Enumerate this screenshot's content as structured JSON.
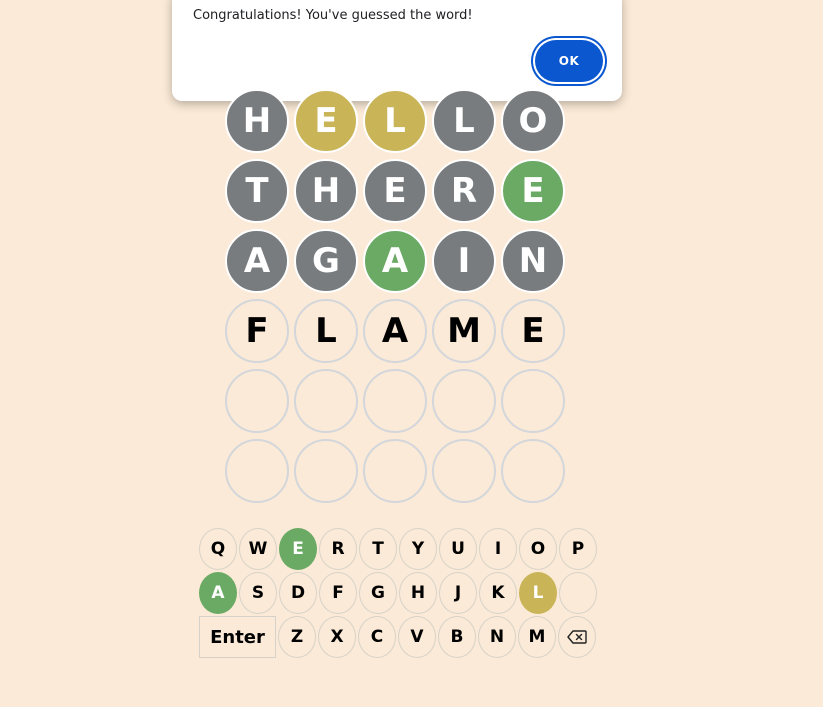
{
  "dialog": {
    "message": "Congratulations! You've guessed the word!",
    "ok_label": "OK"
  },
  "colors": {
    "background": "#fbead7",
    "absent": "#787c7e",
    "present": "#c9b458",
    "correct": "#6aaa64",
    "ok_button": "#0b57d0"
  },
  "board": {
    "rows": [
      {
        "letters": [
          "H",
          "E",
          "L",
          "L",
          "O"
        ],
        "states": [
          "absent",
          "present",
          "present",
          "absent",
          "absent"
        ]
      },
      {
        "letters": [
          "T",
          "H",
          "E",
          "R",
          "E"
        ],
        "states": [
          "absent",
          "absent",
          "absent",
          "absent",
          "correct"
        ]
      },
      {
        "letters": [
          "A",
          "G",
          "A",
          "I",
          "N"
        ],
        "states": [
          "absent",
          "absent",
          "correct",
          "absent",
          "absent"
        ]
      },
      {
        "letters": [
          "F",
          "L",
          "A",
          "M",
          "E"
        ],
        "states": [
          "filled",
          "filled",
          "filled",
          "filled",
          "filled"
        ]
      },
      {
        "letters": [
          "",
          "",
          "",
          "",
          ""
        ],
        "states": [
          "empty",
          "empty",
          "empty",
          "empty",
          "empty"
        ]
      },
      {
        "letters": [
          "",
          "",
          "",
          "",
          ""
        ],
        "states": [
          "empty",
          "empty",
          "empty",
          "empty",
          "empty"
        ]
      }
    ]
  },
  "keyboard": {
    "rows": [
      {
        "keys": [
          "Q",
          "W",
          "E",
          "R",
          "T",
          "Y",
          "U",
          "I",
          "O",
          "P"
        ]
      },
      {
        "keys": [
          "A",
          "S",
          "D",
          "F",
          "G",
          "H",
          "J",
          "K",
          "L",
          ""
        ]
      },
      {
        "keys": [
          "Enter",
          "Z",
          "X",
          "C",
          "V",
          "B",
          "N",
          "M"
        ]
      }
    ],
    "states": {
      "row0": [
        "",
        "",
        "correct",
        "",
        "",
        "",
        "",
        "",
        "",
        ""
      ],
      "row1": [
        "correct",
        "",
        "",
        "",
        "",
        "",
        "",
        "",
        "present",
        ""
      ]
    },
    "backspace_icon": "backspace-icon"
  }
}
